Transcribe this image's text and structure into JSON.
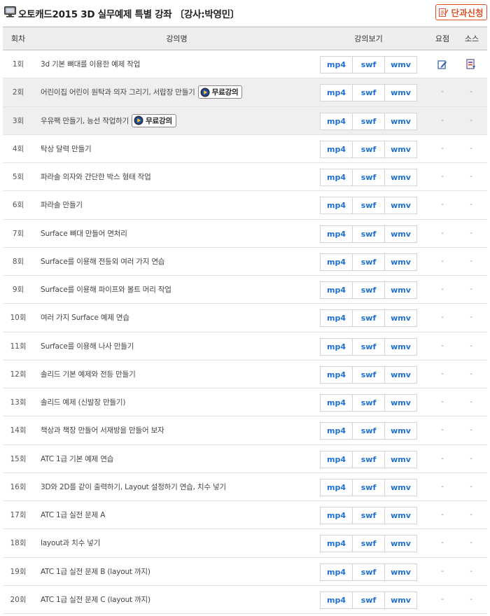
{
  "header": {
    "title": "오토캐드2015 3D 실무예제 특별 강좌 〔강사:박영민〕",
    "apply_label": "단과신청",
    "accent": "#d9542b"
  },
  "columns": {
    "no": "회차",
    "title": "강의명",
    "view": "강의보기",
    "summary": "요점",
    "source": "소스"
  },
  "formats": [
    "mp4",
    "swf",
    "wmv"
  ],
  "free_label": "무료강의",
  "dash": "-",
  "rows": [
    {
      "no": "1회",
      "title": "3d 기본 뼈대를 이용한 예제 작업",
      "free": false,
      "summary_icon": "edit-note-icon",
      "source_icon": "file-download-icon"
    },
    {
      "no": "2회",
      "title": "어린이집 어린이 원탁과 의자 그리기, 서랍장 만들기",
      "free": true
    },
    {
      "no": "3회",
      "title": "우유팩 만들기, 능선 작업하기",
      "free": true
    },
    {
      "no": "4회",
      "title": "탁상 달력 만들기",
      "free": false
    },
    {
      "no": "5회",
      "title": "파라솔 의자와 간단한 박스 형태 작업",
      "free": false
    },
    {
      "no": "6회",
      "title": "파라솔 만들기",
      "free": false
    },
    {
      "no": "7회",
      "title": "Surface 뼈대 만들어 면처리",
      "free": false
    },
    {
      "no": "8회",
      "title": "Surface를 이용해 전등외 여러 가지 연습",
      "free": false
    },
    {
      "no": "9회",
      "title": "Surface를 이용해 파이프와 볼트 머리 작업",
      "free": false
    },
    {
      "no": "10회",
      "title": "여러 가지 Surface 예제 연습",
      "free": false
    },
    {
      "no": "11회",
      "title": "Surface를 이용해 나사 만들기",
      "free": false
    },
    {
      "no": "12회",
      "title": "솔리드 기본 예제와 전등 만들기",
      "free": false
    },
    {
      "no": "13회",
      "title": "솔리드 예제 (신발장 만들기)",
      "free": false
    },
    {
      "no": "14회",
      "title": "책상과 책장 만들어 서재방을 만들어 보자",
      "free": false
    },
    {
      "no": "15회",
      "title": "ATC 1급 기본 예제 연습",
      "free": false
    },
    {
      "no": "16회",
      "title": "3D와 2D를 같이 출력하기, Layout 설정하기 연습, 치수 넣기",
      "free": false
    },
    {
      "no": "17회",
      "title": "ATC 1급 실전 문제 A",
      "free": false
    },
    {
      "no": "18회",
      "title": "layout과 치수 넣기",
      "free": false
    },
    {
      "no": "19회",
      "title": "ATC 1급 실전 문제 B (layout 까지)",
      "free": false
    },
    {
      "no": "20회",
      "title": "ATC 1급 실전 문제 C (layout 까지)",
      "free": false
    }
  ]
}
